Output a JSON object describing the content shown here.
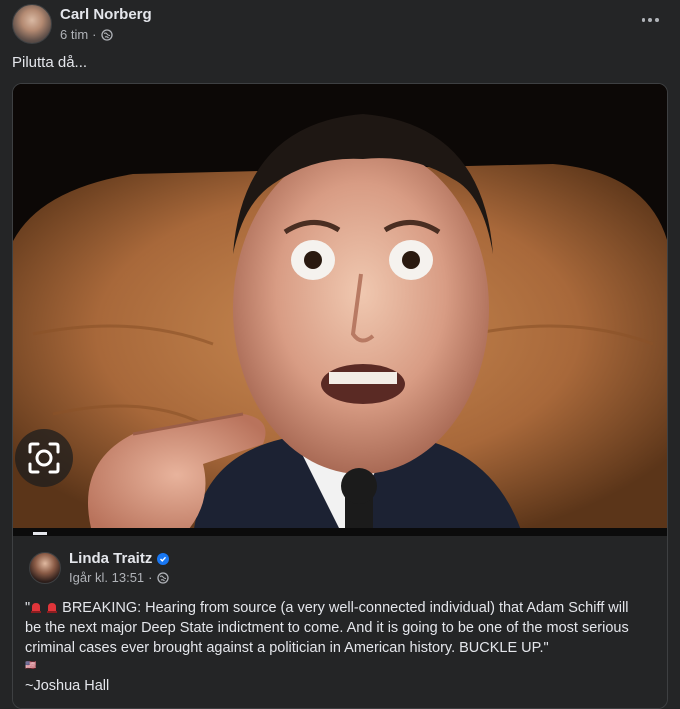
{
  "post": {
    "author": "Carl Norberg",
    "time": "6 tim",
    "separator": "·",
    "privacy_icon": "globe-icon",
    "more_icon": "more-options-icon",
    "caption": "Pilutta då..."
  },
  "shared_post": {
    "author": "Linda Traitz",
    "verified_icon": "verified-badge-icon",
    "time": "Igår kl. 13:51",
    "separator": "·",
    "privacy_icon": "globe-icon",
    "quote_open": "\"",
    "emoji_icons": [
      "siren-icon",
      "siren-icon"
    ],
    "body": "BREAKING: Hearing from source (a very well-connected individual) that Adam Schiff will be the next major Deep State indictment to come. And it is going to be one of the most serious criminal cases ever brought against a politician in American history. BUCKLE UP.\"",
    "small_glyph": "🇺🇸",
    "signoff": "~Joshua Hall"
  },
  "photo": {
    "description_icon": "photo",
    "lens_icon": "visual-search-icon"
  },
  "colors": {
    "background": "#242526",
    "text": "#e4e6eb",
    "secondary_text": "#b0b3b8",
    "border": "#3e4042",
    "verified": "#1877f2"
  }
}
